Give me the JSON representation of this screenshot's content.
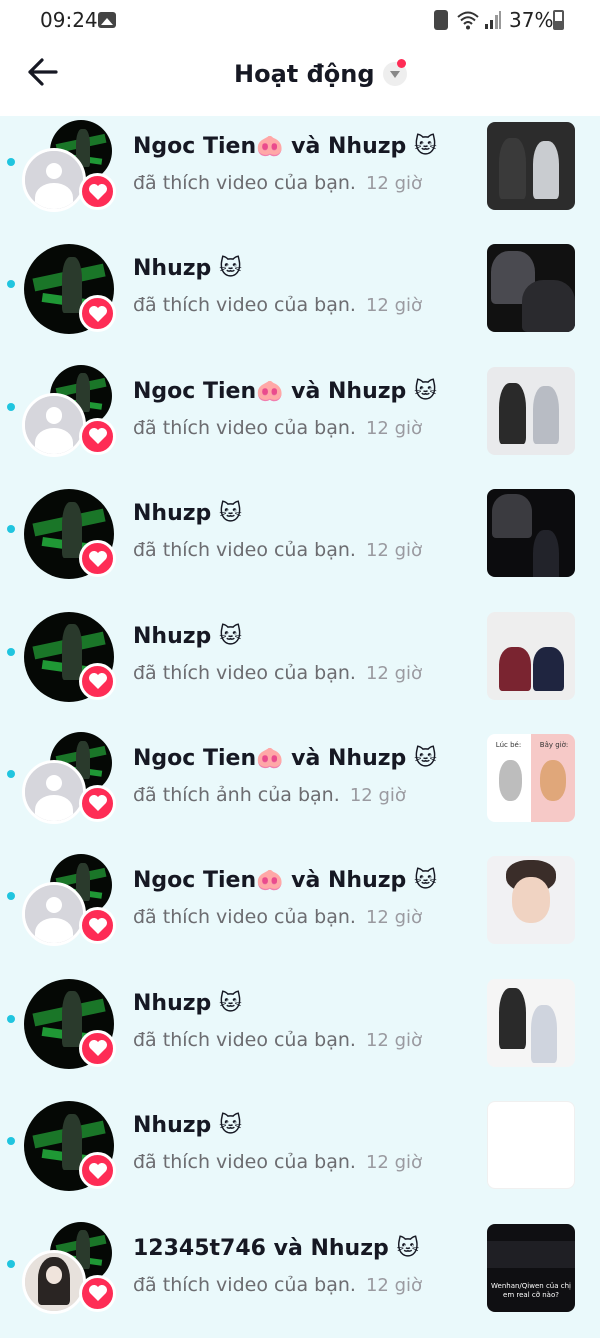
{
  "status_bar": {
    "time": "09:24",
    "battery": "37%",
    "icons": [
      "gallery-icon",
      "recycle-icon",
      "wifi-icon",
      "signal-icon",
      "battery-icon"
    ]
  },
  "header": {
    "title": "Hoạt động",
    "back_icon": "arrow-left-icon",
    "dropdown_icon": "chevron-down-icon",
    "notification_dot_color": "#fe2c55"
  },
  "colors": {
    "background": "#eaf9fb",
    "unread_dot": "#20c5df",
    "like_badge": "#fe2c55",
    "name_text": "#161823",
    "description_text": "#6c6c70",
    "time_text": "#9a9aa0"
  },
  "notifications": [
    {
      "name": "Ngoc Tien🐽 và Nhuzp 🐱",
      "description": "đã thích video của bạn.",
      "time": "12 giờ",
      "avatar": "pair-default"
    },
    {
      "name": "Nhuzp 🐱",
      "description": "đã thích video của bạn.",
      "time": "12 giờ",
      "avatar": "single"
    },
    {
      "name": "Ngoc Tien🐽 và Nhuzp 🐱",
      "description": "đã thích video của bạn.",
      "time": "12 giờ",
      "avatar": "pair-default"
    },
    {
      "name": "Nhuzp 🐱",
      "description": "đã thích video của bạn.",
      "time": "12 giờ",
      "avatar": "single"
    },
    {
      "name": "Nhuzp 🐱",
      "description": "đã thích video của bạn.",
      "time": "12 giờ",
      "avatar": "single"
    },
    {
      "name": "Ngoc Tien🐽 và Nhuzp 🐱",
      "description": "đã thích ảnh của bạn.",
      "time": "12 giờ",
      "avatar": "pair-default",
      "thumbnail_labels": [
        "Lúc bé:",
        "Bây giờ:"
      ]
    },
    {
      "name": "Ngoc Tien🐽 và Nhuzp 🐱",
      "description": "đã thích video của bạn.",
      "time": "12 giờ",
      "avatar": "pair-default"
    },
    {
      "name": "Nhuzp 🐱",
      "description": "đã thích video của bạn.",
      "time": "12 giờ",
      "avatar": "single"
    },
    {
      "name": "Nhuzp 🐱",
      "description": "đã thích video của bạn.",
      "time": "12 giờ",
      "avatar": "single"
    },
    {
      "name": "12345t746 và Nhuzp 🐱",
      "description": "đã thích video của bạn.",
      "time": "12 giờ",
      "avatar": "pair-custom",
      "thumbnail_caption": "Wenhan/Qiwen của chị em real cỡ nào?"
    }
  ]
}
